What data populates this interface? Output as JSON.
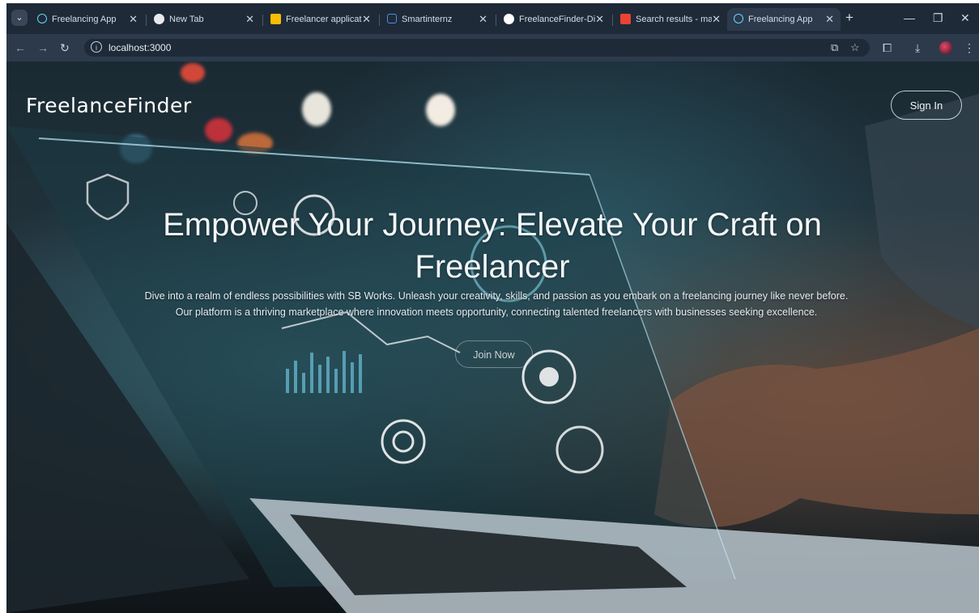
{
  "browser": {
    "tabs": [
      {
        "title": "Freelancing App",
        "favicon": "react-icon",
        "color": "#61dafb"
      },
      {
        "title": "New Tab",
        "favicon": "chrome-icon",
        "color": "#e8eaed"
      },
      {
        "title": "Freelancer applicatio",
        "favicon": "google-drive-icon",
        "color": "#fbbc04"
      },
      {
        "title": "Smartinternz",
        "favicon": "smartinternz-icon",
        "color": "#4f8fe6"
      },
      {
        "title": "FreelanceFinder-Dis",
        "favicon": "github-icon",
        "color": "#ffffff"
      },
      {
        "title": "Search results - man",
        "favicon": "gmail-icon",
        "color": "#ea4335"
      },
      {
        "title": "Freelancing App",
        "favicon": "react-icon",
        "color": "#61dafb",
        "active": true
      }
    ],
    "url": "localhost:3000"
  },
  "page": {
    "brand": "FreelanceFinder",
    "signin_label": "Sign In",
    "hero": {
      "title": "Empower Your Journey: Elevate Your Craft on Freelancer",
      "description": "Dive into a realm of endless possibilities with SB Works. Unleash your creativity, skills, and passion as you embark on a freelancing journey like never before. Our platform is a thriving marketplace where innovation meets opportunity, connecting talented freelancers with businesses seeking excellence.",
      "cta_label": "Join Now"
    }
  },
  "colors": {
    "tabstrip": "#1e2a38",
    "toolbar": "#2c3a4c",
    "hero_text": "#f3f6f9"
  }
}
